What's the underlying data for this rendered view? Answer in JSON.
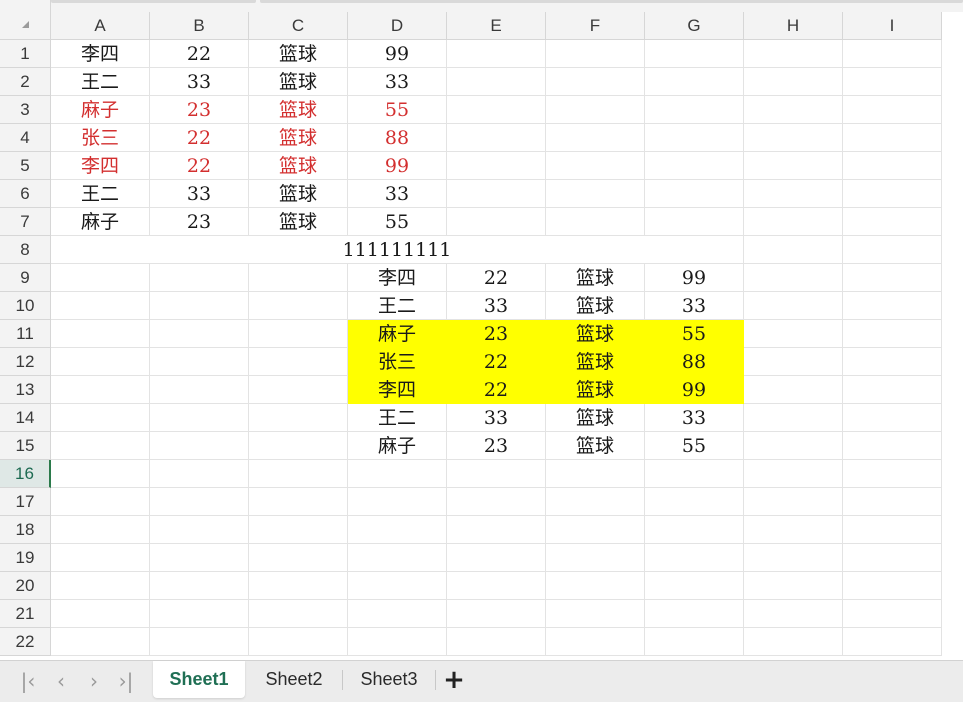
{
  "columns": [
    "A",
    "B",
    "C",
    "D",
    "E",
    "F",
    "G",
    "H",
    "I"
  ],
  "rows": [
    "1",
    "2",
    "3",
    "4",
    "5",
    "6",
    "7",
    "8",
    "9",
    "10",
    "11",
    "12",
    "13",
    "14",
    "15",
    "16",
    "17",
    "18",
    "19",
    "20",
    "21",
    "22"
  ],
  "active_row": "16",
  "colors": {
    "red_text": "#d32f2f",
    "highlight_fill": "#ffff00",
    "active_accent": "#2b7a4b",
    "active_tab_text": "#1f6f54"
  },
  "cells": [
    {
      "ref": "A1",
      "value": "李四"
    },
    {
      "ref": "B1",
      "value": "22"
    },
    {
      "ref": "C1",
      "value": "篮球"
    },
    {
      "ref": "D1",
      "value": "99"
    },
    {
      "ref": "A2",
      "value": "王二"
    },
    {
      "ref": "B2",
      "value": "33"
    },
    {
      "ref": "C2",
      "value": "篮球"
    },
    {
      "ref": "D2",
      "value": "33"
    },
    {
      "ref": "A3",
      "value": "麻子",
      "style": "red"
    },
    {
      "ref": "B3",
      "value": "23",
      "style": "red"
    },
    {
      "ref": "C3",
      "value": "篮球",
      "style": "red"
    },
    {
      "ref": "D3",
      "value": "55",
      "style": "red"
    },
    {
      "ref": "A4",
      "value": "张三",
      "style": "red"
    },
    {
      "ref": "B4",
      "value": "22",
      "style": "red"
    },
    {
      "ref": "C4",
      "value": "篮球",
      "style": "red"
    },
    {
      "ref": "D4",
      "value": "88",
      "style": "red"
    },
    {
      "ref": "A5",
      "value": "李四",
      "style": "red"
    },
    {
      "ref": "B5",
      "value": "22",
      "style": "red"
    },
    {
      "ref": "C5",
      "value": "篮球",
      "style": "red"
    },
    {
      "ref": "D5",
      "value": "99",
      "style": "red"
    },
    {
      "ref": "A6",
      "value": "王二"
    },
    {
      "ref": "B6",
      "value": "33"
    },
    {
      "ref": "C6",
      "value": "篮球"
    },
    {
      "ref": "D6",
      "value": "33"
    },
    {
      "ref": "A7",
      "value": "麻子"
    },
    {
      "ref": "B7",
      "value": "23"
    },
    {
      "ref": "C7",
      "value": "篮球"
    },
    {
      "ref": "D7",
      "value": "55"
    },
    {
      "ref": "A8",
      "value": "111111111",
      "span": 7
    },
    {
      "ref": "D9",
      "value": "李四"
    },
    {
      "ref": "E9",
      "value": "22"
    },
    {
      "ref": "F9",
      "value": "篮球"
    },
    {
      "ref": "G9",
      "value": "99"
    },
    {
      "ref": "D10",
      "value": "王二"
    },
    {
      "ref": "E10",
      "value": "33"
    },
    {
      "ref": "F10",
      "value": "篮球"
    },
    {
      "ref": "G10",
      "value": "33"
    },
    {
      "ref": "D11",
      "value": "麻子",
      "style": "yellow"
    },
    {
      "ref": "E11",
      "value": "23",
      "style": "yellow"
    },
    {
      "ref": "F11",
      "value": "篮球",
      "style": "yellow"
    },
    {
      "ref": "G11",
      "value": "55",
      "style": "yellow"
    },
    {
      "ref": "D12",
      "value": "张三",
      "style": "yellow"
    },
    {
      "ref": "E12",
      "value": "22",
      "style": "yellow"
    },
    {
      "ref": "F12",
      "value": "篮球",
      "style": "yellow"
    },
    {
      "ref": "G12",
      "value": "88",
      "style": "yellow"
    },
    {
      "ref": "D13",
      "value": "李四",
      "style": "yellow"
    },
    {
      "ref": "E13",
      "value": "22",
      "style": "yellow"
    },
    {
      "ref": "F13",
      "value": "篮球",
      "style": "yellow"
    },
    {
      "ref": "G13",
      "value": "99",
      "style": "yellow"
    },
    {
      "ref": "D14",
      "value": "王二"
    },
    {
      "ref": "E14",
      "value": "33"
    },
    {
      "ref": "F14",
      "value": "篮球"
    },
    {
      "ref": "G14",
      "value": "33"
    },
    {
      "ref": "D15",
      "value": "麻子"
    },
    {
      "ref": "E15",
      "value": "23"
    },
    {
      "ref": "F15",
      "value": "篮球"
    },
    {
      "ref": "G15",
      "value": "55"
    }
  ],
  "tabbar": {
    "nav_icons": [
      "first-sheet-icon",
      "prev-sheet-icon",
      "next-sheet-icon",
      "last-sheet-icon"
    ],
    "sheets": [
      {
        "label": "Sheet1",
        "active": true
      },
      {
        "label": "Sheet2",
        "active": false
      },
      {
        "label": "Sheet3",
        "active": false
      }
    ],
    "add_icon": "plus-icon"
  }
}
